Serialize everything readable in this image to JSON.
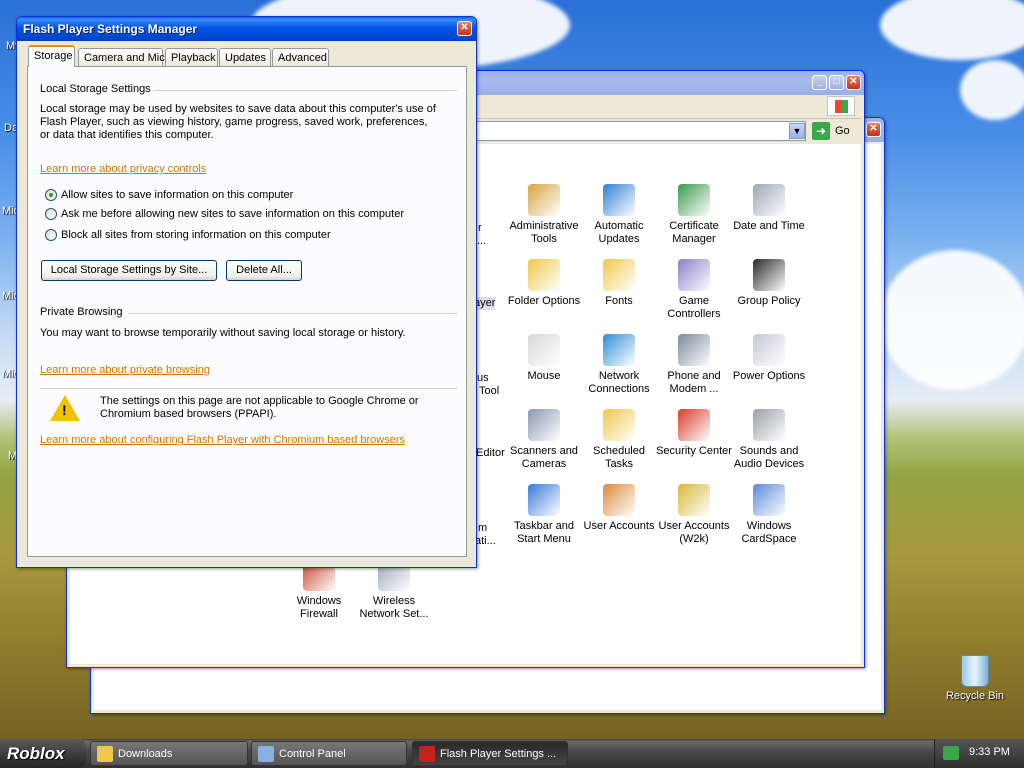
{
  "desktop": {
    "icons": [
      {
        "label": "Recycle Bin"
      }
    ],
    "partial_labels": [
      "My",
      "Da",
      "Mic",
      "Mic",
      "Mic",
      "M"
    ]
  },
  "control_panel": {
    "go_label": "Go",
    "items": [
      {
        "label": "Administrative Tools",
        "icon": "admin-tools-icon",
        "color": "#d9a441"
      },
      {
        "label": "Automatic Updates",
        "icon": "windows-logo-icon",
        "color": "#2f7fd6"
      },
      {
        "label": "Certificate Manager",
        "icon": "certificate-icon",
        "color": "#3a9a4a"
      },
      {
        "label": "Date and Time",
        "icon": "clock-icon",
        "color": "#9aa6b8"
      },
      {
        "label": "Folder Options",
        "icon": "folder-options-icon",
        "color": "#f0c84a"
      },
      {
        "label": "Fonts",
        "icon": "fonts-folder-icon",
        "color": "#f0c84a"
      },
      {
        "label": "Game Controllers",
        "icon": "gamepad-icon",
        "color": "#8c7fc8"
      },
      {
        "label": "Group Policy",
        "icon": "group-policy-icon",
        "color": "#2a2a2a"
      },
      {
        "label": "Mouse",
        "icon": "mouse-icon",
        "color": "#d8d8d8"
      },
      {
        "label": "Network Connections",
        "icon": "network-globe-icon",
        "color": "#2f8fd6"
      },
      {
        "label": "Phone and Modem ...",
        "icon": "phone-icon",
        "color": "#7a8a9a"
      },
      {
        "label": "Power Options",
        "icon": "power-plug-icon",
        "color": "#c8c8d8"
      },
      {
        "label": "Scanners and Cameras",
        "icon": "scanner-icon",
        "color": "#8a9ab0"
      },
      {
        "label": "Scheduled Tasks",
        "icon": "scheduled-tasks-icon",
        "color": "#f0c84a"
      },
      {
        "label": "Security Center",
        "icon": "shield-icon",
        "color": "#d63a2a"
      },
      {
        "label": "Sounds and Audio Devices",
        "icon": "speaker-icon",
        "color": "#9aa0a8"
      },
      {
        "label": "Taskbar and Start Menu",
        "icon": "taskbar-icon",
        "color": "#3a7ad6"
      },
      {
        "label": "User Accounts",
        "icon": "users-icon",
        "color": "#d88a3a"
      },
      {
        "label": "User Accounts (W2k)",
        "icon": "user-key-icon",
        "color": "#d8b83a"
      },
      {
        "label": "Windows CardSpace",
        "icon": "cardspace-icon",
        "color": "#5a8ad6"
      },
      {
        "label": "Windows Firewall",
        "icon": "firewall-icon",
        "color": "#c8402a"
      },
      {
        "label": "Wireless Network Set...",
        "icon": "wireless-icon",
        "color": "#9aa6b8"
      }
    ],
    "clipped_labels": [
      "r",
      "...",
      "ayer",
      "us",
      "Tool",
      "Editor",
      "m",
      "ati..."
    ]
  },
  "flash": {
    "title": "Flash Player Settings Manager",
    "tabs": [
      "Storage",
      "Camera and Mic",
      "Playback",
      "Updates",
      "Advanced"
    ],
    "local_heading": "Local Storage Settings",
    "local_desc": "Local storage may be used by websites to save data about this computer's use of Flash Player, such as viewing history, game progress, saved work, preferences, or data that identifies this computer.",
    "privacy_link": "Learn more about privacy controls",
    "radios": [
      {
        "label": "Allow sites to save information on this computer",
        "selected": true
      },
      {
        "label": "Ask me before allowing new sites to save information on this computer",
        "selected": false
      },
      {
        "label": "Block all sites from storing information on this computer",
        "selected": false
      }
    ],
    "btn_by_site": "Local Storage Settings by Site...",
    "btn_delete": "Delete All...",
    "private_heading": "Private Browsing",
    "private_desc": "You may want to browse temporarily without saving local storage or history.",
    "private_link": "Learn more about private browsing",
    "warning_text": "The settings on this page are not applicable to Google Chrome or Chromium based browsers (PPAPI).",
    "chromium_link": "Learn more about configuring Flash Player with Chromium based browsers"
  },
  "taskbar": {
    "start_label": "Roblox",
    "tasks": [
      {
        "label": "Downloads",
        "active": false
      },
      {
        "label": "Control Panel",
        "active": false
      },
      {
        "label": "Flash Player Settings ...",
        "active": true
      }
    ],
    "clock": "9:33 PM"
  }
}
